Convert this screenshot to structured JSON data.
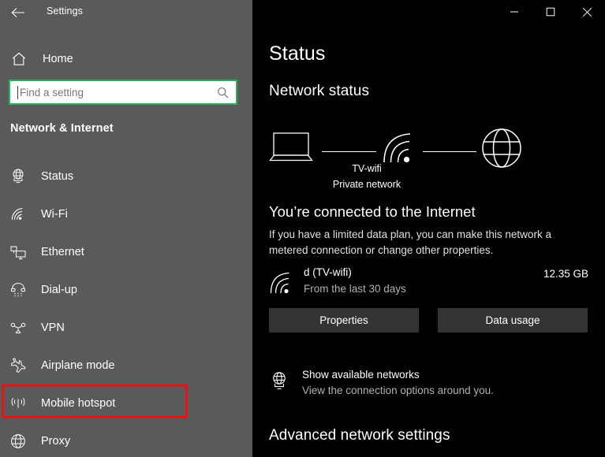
{
  "window": {
    "titlebar_label": "Settings",
    "back_icon": "back-arrow-icon",
    "controls": {
      "minimize_label": "Minimize",
      "maximize_label": "Maximize",
      "close_label": "Close"
    }
  },
  "sidebar": {
    "home": {
      "label": "Home",
      "icon": "home-icon"
    },
    "search": {
      "placeholder": "Find a setting",
      "value": "",
      "icon": "search-icon",
      "focus_border_color": "#21b459"
    },
    "category_title": "Network & Internet",
    "items": [
      {
        "label": "Status",
        "icon": "status-globe-monitor-icon",
        "selected": false
      },
      {
        "label": "Wi-Fi",
        "icon": "wifi-icon",
        "selected": false
      },
      {
        "label": "Ethernet",
        "icon": "ethernet-icon",
        "selected": false
      },
      {
        "label": "Dial-up",
        "icon": "dialup-phone-icon",
        "selected": false
      },
      {
        "label": "VPN",
        "icon": "vpn-icon",
        "selected": false
      },
      {
        "label": "Airplane mode",
        "icon": "airplane-icon",
        "selected": false
      },
      {
        "label": "Mobile hotspot",
        "icon": "mobile-hotspot-icon",
        "selected": false,
        "highlighted": true
      },
      {
        "label": "Proxy",
        "icon": "proxy-globe-icon",
        "selected": false
      }
    ],
    "highlight_color": "#ee1111",
    "background_color": "#5a5a5a"
  },
  "main": {
    "page_title": "Status",
    "network_status_heading": "Network status",
    "diagram": {
      "device_icon": "laptop-icon",
      "network_icon": "wifi-icon",
      "internet_icon": "globe-icon",
      "network_name": "TV-wifi",
      "network_type": "Private network"
    },
    "connected_heading": "You’re connected to the Internet",
    "connected_description": "If you have a limited data plan, you can make this network a metered connection or change other properties.",
    "usage": {
      "icon": "wifi-icon",
      "network_name": "d (TV-wifi)",
      "period": "From the last 30 days",
      "amount": "12.35 GB"
    },
    "buttons": {
      "properties_label": "Properties",
      "data_usage_label": "Data usage"
    },
    "available_networks": {
      "icon": "network-globe-icon",
      "title": "Show available networks",
      "subtitle": "View the connection options around you."
    },
    "advanced_heading": "Advanced network settings"
  }
}
